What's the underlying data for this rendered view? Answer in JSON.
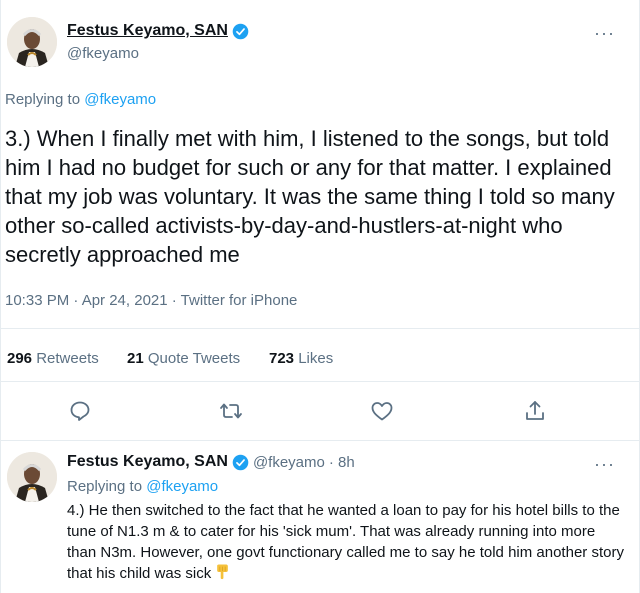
{
  "main_tweet": {
    "display_name": "Festus Keyamo, SAN",
    "handle": "@fkeyamo",
    "replying_label": "Replying to",
    "replying_to": "@fkeyamo",
    "text": "3.) When I finally met with him, I listened to the songs, but told him I had no budget for such or any for that matter. I explained that my job was voluntary. It was the same thing I told so many other so-called activists-by-day-and-hustlers-at-night who secretly approached me",
    "timestamp": "10:33 PM · Apr 24, 2021 · Twitter for iPhone",
    "stats": {
      "retweets_count": "296",
      "retweets_label": "Retweets",
      "quotes_count": "21",
      "quotes_label": "Quote Tweets",
      "likes_count": "723",
      "likes_label": "Likes"
    },
    "actions": [
      "reply-icon",
      "retweet-icon",
      "like-icon",
      "share-icon"
    ]
  },
  "reply_tweet": {
    "display_name": "Festus Keyamo, SAN",
    "handle": "@fkeyamo",
    "time": "· 8h",
    "replying_label": "Replying to",
    "replying_to": "@fkeyamo",
    "text": "4.) He then switched to the fact that he wanted a loan to pay for his hotel bills to the tune of N1.3 m & to cater for his 'sick mum'. That was already running into more than N3m. However, one govt functionary called me to say he told him another story that his child was sick",
    "emoji": "pointing-down-emoji"
  },
  "more_label": "···",
  "colors": {
    "accent": "#1da1f2",
    "text": "#0f1419",
    "secondary": "#5b7083",
    "border": "#e6ecf0"
  }
}
